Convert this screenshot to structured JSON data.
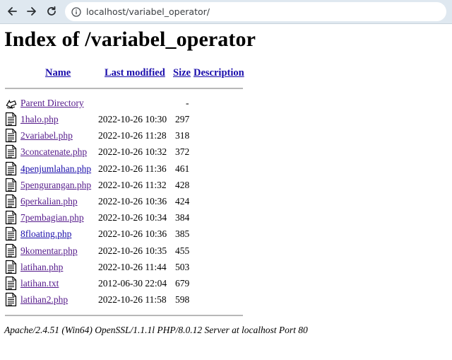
{
  "browser": {
    "url": "localhost/variabel_operator/"
  },
  "page": {
    "title": "Index of /variabel_operator",
    "columns": {
      "name": "Name",
      "last_modified": "Last modified",
      "size": "Size",
      "description": "Description"
    },
    "parent": {
      "label": "Parent Directory",
      "size": "-"
    },
    "files": [
      {
        "name": "1halo.php",
        "modified": "2022-10-26 10:30",
        "size": "297"
      },
      {
        "name": "2variabel.php",
        "modified": "2022-10-26 11:28",
        "size": "318"
      },
      {
        "name": "3concatenate.php",
        "modified": "2022-10-26 10:32",
        "size": "372"
      },
      {
        "name": "4penjumlahan.php",
        "modified": "2022-10-26 11:36",
        "size": "461"
      },
      {
        "name": "5pengurangan.php",
        "modified": "2022-10-26 11:32",
        "size": "428"
      },
      {
        "name": "6perkalian.php",
        "modified": "2022-10-26 10:36",
        "size": "424"
      },
      {
        "name": "7pembagian.php",
        "modified": "2022-10-26 10:34",
        "size": "384"
      },
      {
        "name": "8floating.php",
        "modified": "2022-10-26 10:36",
        "size": "385"
      },
      {
        "name": "9komentar.php",
        "modified": "2022-10-26 10:35",
        "size": "455"
      },
      {
        "name": "latihan.php",
        "modified": "2022-10-26 11:44",
        "size": "503"
      },
      {
        "name": "latihan.txt",
        "modified": "2012-06-30 22:04",
        "size": "679"
      },
      {
        "name": "latihan2.php",
        "modified": "2022-10-26 11:58",
        "size": "598"
      }
    ],
    "footer": "Apache/2.4.51 (Win64) OpenSSL/1.1.1l PHP/8.0.12 Server at localhost Port 80"
  }
}
